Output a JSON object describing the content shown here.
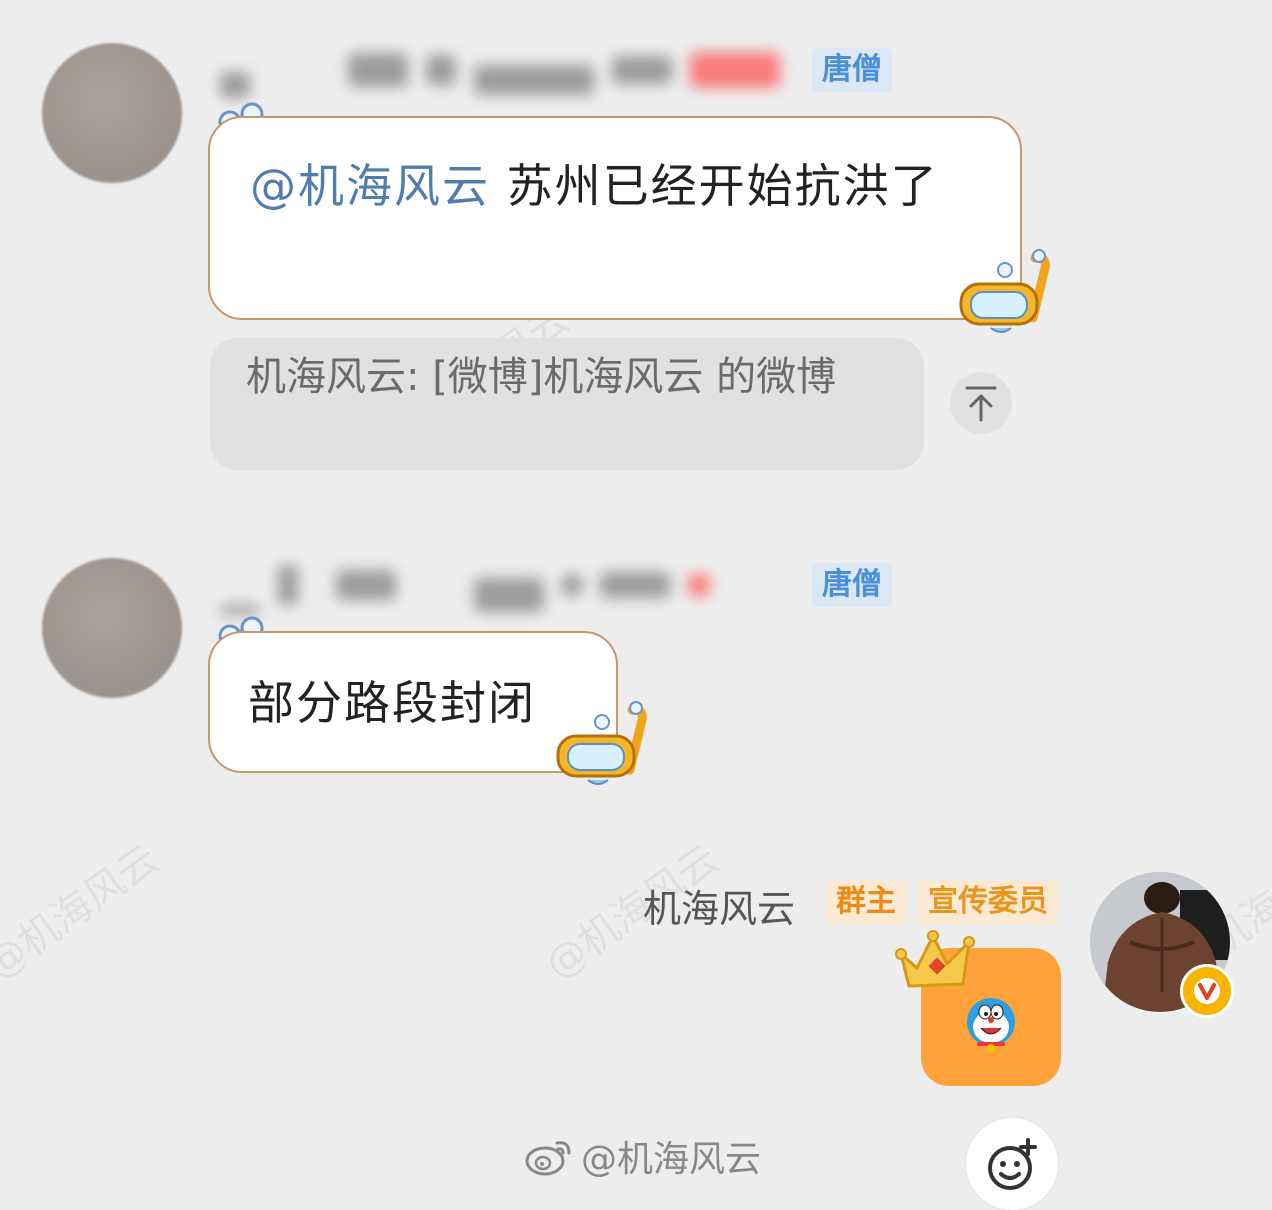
{
  "watermark_text": "@机海风云",
  "messages": [
    {
      "badge": "唐僧",
      "mention": "@机海风云",
      "text": " 苏州已经开始抗洪了",
      "quote": "机海风云: [微博]机海风云 的微博",
      "avatar_icon": "blurred-avatar"
    },
    {
      "badge": "唐僧",
      "text": "部分路段封闭",
      "avatar_icon": "blurred-avatar"
    }
  ],
  "self_message": {
    "name": "机海风云",
    "owner_tag": "群主",
    "role_tag": "宣传委员",
    "sticker_icon": "doraemon-icon",
    "decoration_icon": "crown-icon"
  },
  "footer": {
    "weibo_handle": "@机海风云"
  },
  "colors": {
    "background": "#ededed",
    "bubble_border": "#c79768",
    "mention": "#507daf",
    "badge_blue": "#4a90d9",
    "owner_orange": "#ef8a14",
    "sticker_bubble": "#ffa239"
  }
}
